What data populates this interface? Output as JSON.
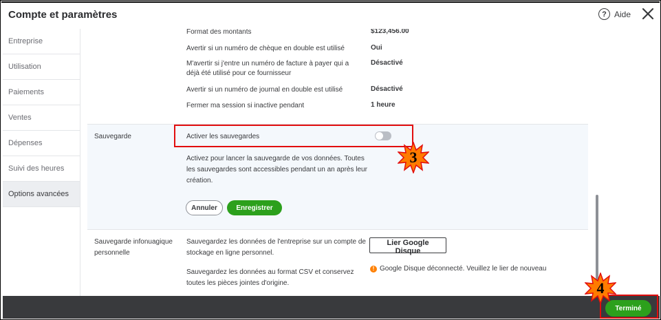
{
  "header": {
    "title": "Compte et paramètres",
    "help_label": "Aide",
    "help_glyph": "?",
    "close_glyph": "✕"
  },
  "sidebar": {
    "items": [
      {
        "label": "Entreprise",
        "active": false
      },
      {
        "label": "Utilisation",
        "active": false
      },
      {
        "label": "Paiements",
        "active": false
      },
      {
        "label": "Ventes",
        "active": false
      },
      {
        "label": "Dépenses",
        "active": false
      },
      {
        "label": "Suivi des heures",
        "active": false
      },
      {
        "label": "Options avancées",
        "active": true
      }
    ]
  },
  "other_settings": [
    {
      "label": "Format des montants",
      "value": "$123,456.00"
    },
    {
      "label": "Avertir si un numéro de chèque en double est utilisé",
      "value": "Oui"
    },
    {
      "label": "M'avertir si j'entre un numéro de facture à payer qui a déjà été utilisé pour ce fournisseur",
      "value": "Désactivé"
    },
    {
      "label": "Avertir si un numéro de journal en double est utilisé",
      "value": "Désactivé"
    },
    {
      "label": "Fermer ma session si inactive pendant",
      "value": "1 heure"
    }
  ],
  "backup": {
    "section_title": "Sauvegarde",
    "toggle_label": "Activer les sauvegardes",
    "toggle_on": false,
    "description": "Activez pour lancer la sauvegarde de vos données. Toutes les sauvegardes sont accessibles pendant un an après leur création.",
    "cancel_label": "Annuler",
    "save_label": "Enregistrer"
  },
  "cloud_backup": {
    "section_title": "Sauvegarde infonuagique personnelle",
    "description1": "Sauvegardez les données de l'entreprise sur un compte de stockage en ligne personnel.",
    "description2": "Sauvegardez les données au format CSV et conservez toutes les pièces jointes d'origine.",
    "link_button_label": "Lier Google Disque",
    "warning_glyph": "!",
    "warning_text": "Google Disque déconnecté. Veuillez le lier de nouveau"
  },
  "footer": {
    "done_label": "Terminé"
  },
  "annotations": {
    "step3": "3",
    "step4": "4"
  },
  "colors": {
    "accent_green": "#2ca01c",
    "annotation_red": "#e20d0d",
    "badge_fill": "#ff7b00",
    "footer_bg": "#393a3d"
  }
}
